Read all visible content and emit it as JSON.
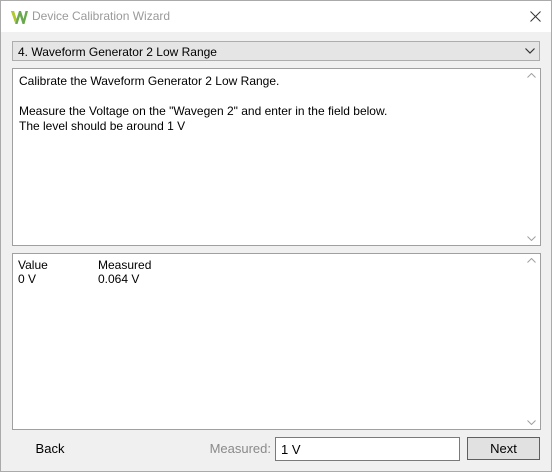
{
  "window": {
    "title": "Device Calibration Wizard",
    "icon": "w-logo-icon"
  },
  "step": {
    "selected": "4. Waveform Generator 2 Low Range"
  },
  "instructions": {
    "text": "Calibrate the Waveform Generator 2 Low Range.\n\nMeasure the Voltage on the \"Wavegen 2\" and enter in the field below.\nThe level should be around 1 V"
  },
  "results": {
    "headers": [
      "Value",
      "Measured"
    ],
    "rows": [
      [
        "0 V",
        "0.064 V"
      ]
    ]
  },
  "footer": {
    "back_label": "Back",
    "measured_label": "Measured:",
    "measured_value": "1 V",
    "next_label": "Next"
  },
  "colors": {
    "logo_green": "#6aa84f",
    "accent": "#0078d7"
  }
}
